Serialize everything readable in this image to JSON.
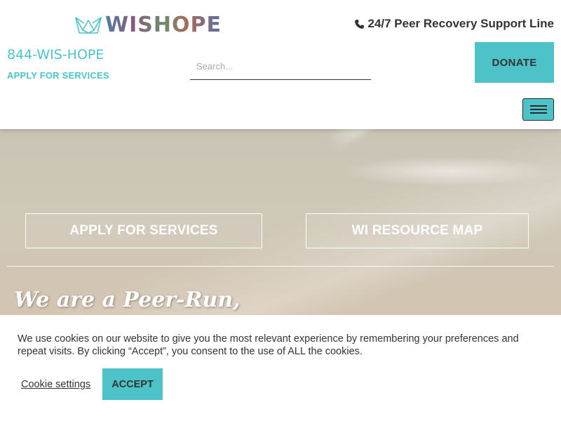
{
  "header": {
    "logo_text": "WISHOPE",
    "support_line": "24/7 Peer Recovery Support Line",
    "phone": "844-WIS-HOPE",
    "apply_link": "APPLY FOR SERVICES",
    "search_placeholder": "Search...",
    "donate_label": "DONATE",
    "menu_icon": "hamburger-icon",
    "phone_icon": "phone-icon"
  },
  "hero": {
    "buttons": [
      {
        "label": "APPLY FOR SERVICES"
      },
      {
        "label": "WI RESOURCE MAP"
      }
    ],
    "tagline": "We are a Peer-Run,"
  },
  "cookie_banner": {
    "text": "We use cookies on our website to give you the most relevant experience by remembering your preferences and repeat visits. By clicking “Accept”, you consent to the use of ALL the cookies.",
    "settings_label": "Cookie settings",
    "accept_label": "ACCEPT"
  },
  "colors": {
    "accent": "#4dc3c9",
    "text": "#333333"
  }
}
